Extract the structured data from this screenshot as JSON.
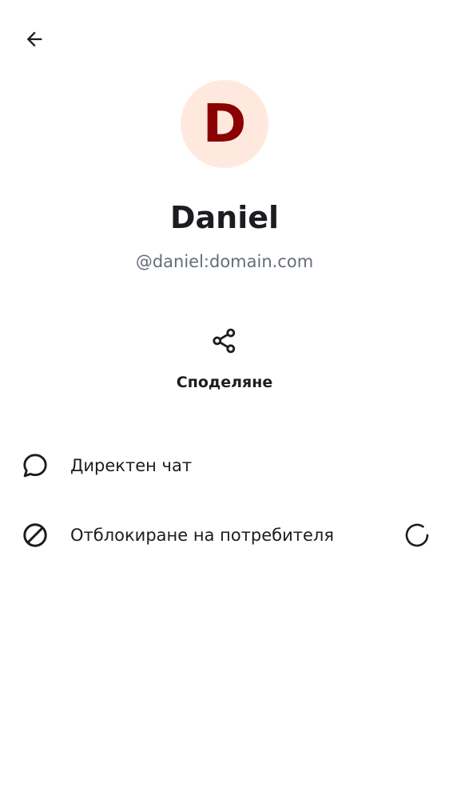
{
  "colors": {
    "text_primary": "#1b1d21",
    "text_secondary": "#656d77",
    "avatar_bg": "#ffe9de",
    "avatar_letter": "#8b0000",
    "background": "#ffffff"
  },
  "header": {
    "back_icon": "arrow-back-icon"
  },
  "profile": {
    "avatar_initial": "D",
    "display_name": "Daniel",
    "user_id": "@daniel:domain.com"
  },
  "actions": {
    "share": {
      "icon": "share-icon",
      "label": "Споделяне"
    }
  },
  "list": [
    {
      "icon": "chat-bubble-icon",
      "label": "Директен чат"
    },
    {
      "icon": "block-icon",
      "label": "Отблокиране на потребителя",
      "trailing": "loading-spinner"
    }
  ]
}
